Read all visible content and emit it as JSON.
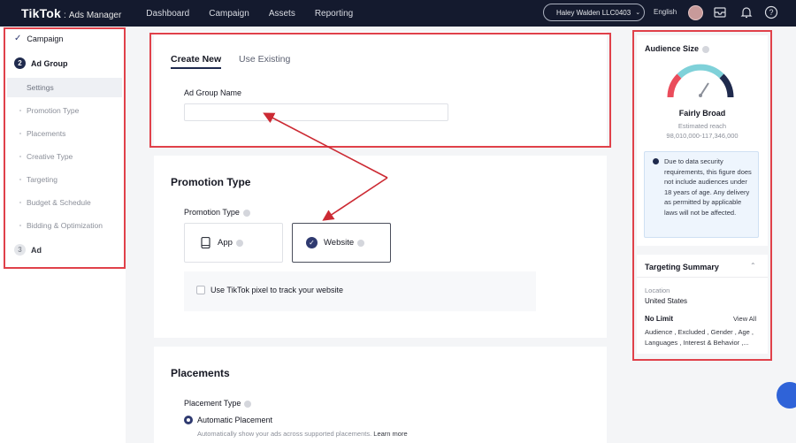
{
  "topbar": {
    "logo": "TikTok",
    "logo_separator": ":",
    "logo_sub": "Ads Manager",
    "nav": [
      "Dashboard",
      "Campaign",
      "Assets",
      "Reporting"
    ],
    "account": "Haley Walden LLC0403",
    "language": "English"
  },
  "sidebar": {
    "campaign": "Campaign",
    "ad_group_num": "2",
    "ad_group": "Ad Group",
    "substeps": [
      "Settings",
      "Promotion Type",
      "Placements",
      "Creative Type",
      "Targeting",
      "Budget & Schedule",
      "Bidding & Optimization"
    ],
    "ad_num": "3",
    "ad": "Ad"
  },
  "create": {
    "tab_new": "Create New",
    "tab_existing": "Use Existing",
    "name_label": "Ad Group Name",
    "name_value": ""
  },
  "promotion": {
    "title": "Promotion Type",
    "label": "Promotion Type",
    "app": "App",
    "website": "Website",
    "pixel": "Use TikTok pixel to track your website"
  },
  "placements": {
    "title": "Placements",
    "label": "Placement Type",
    "automatic": "Automatic Placement",
    "automatic_desc": "Automatically show your ads across supported placements.",
    "learn_more": "Learn more"
  },
  "audience": {
    "title": "Audience Size",
    "level": "Fairly Broad",
    "reach_label": "Estimated reach",
    "reach_value": "98,010,000-117,346,000",
    "notice": "Due to data security requirements, this figure does not include audiences under 18 years of age. Any delivery as permitted by applicable laws will not be affected."
  },
  "targeting": {
    "title": "Targeting Summary",
    "location_label": "Location",
    "location_value": "United States",
    "no_limit": "No Limit",
    "view_all": "View All",
    "summary": "Audience , Excluded , Gender , Age , Languages , Interest & Behavior ,..."
  },
  "colors": {
    "highlight": "#e0414a",
    "topbar": "#141a2e",
    "accent": "#2f3a70",
    "arrow": "#cc2a33"
  }
}
